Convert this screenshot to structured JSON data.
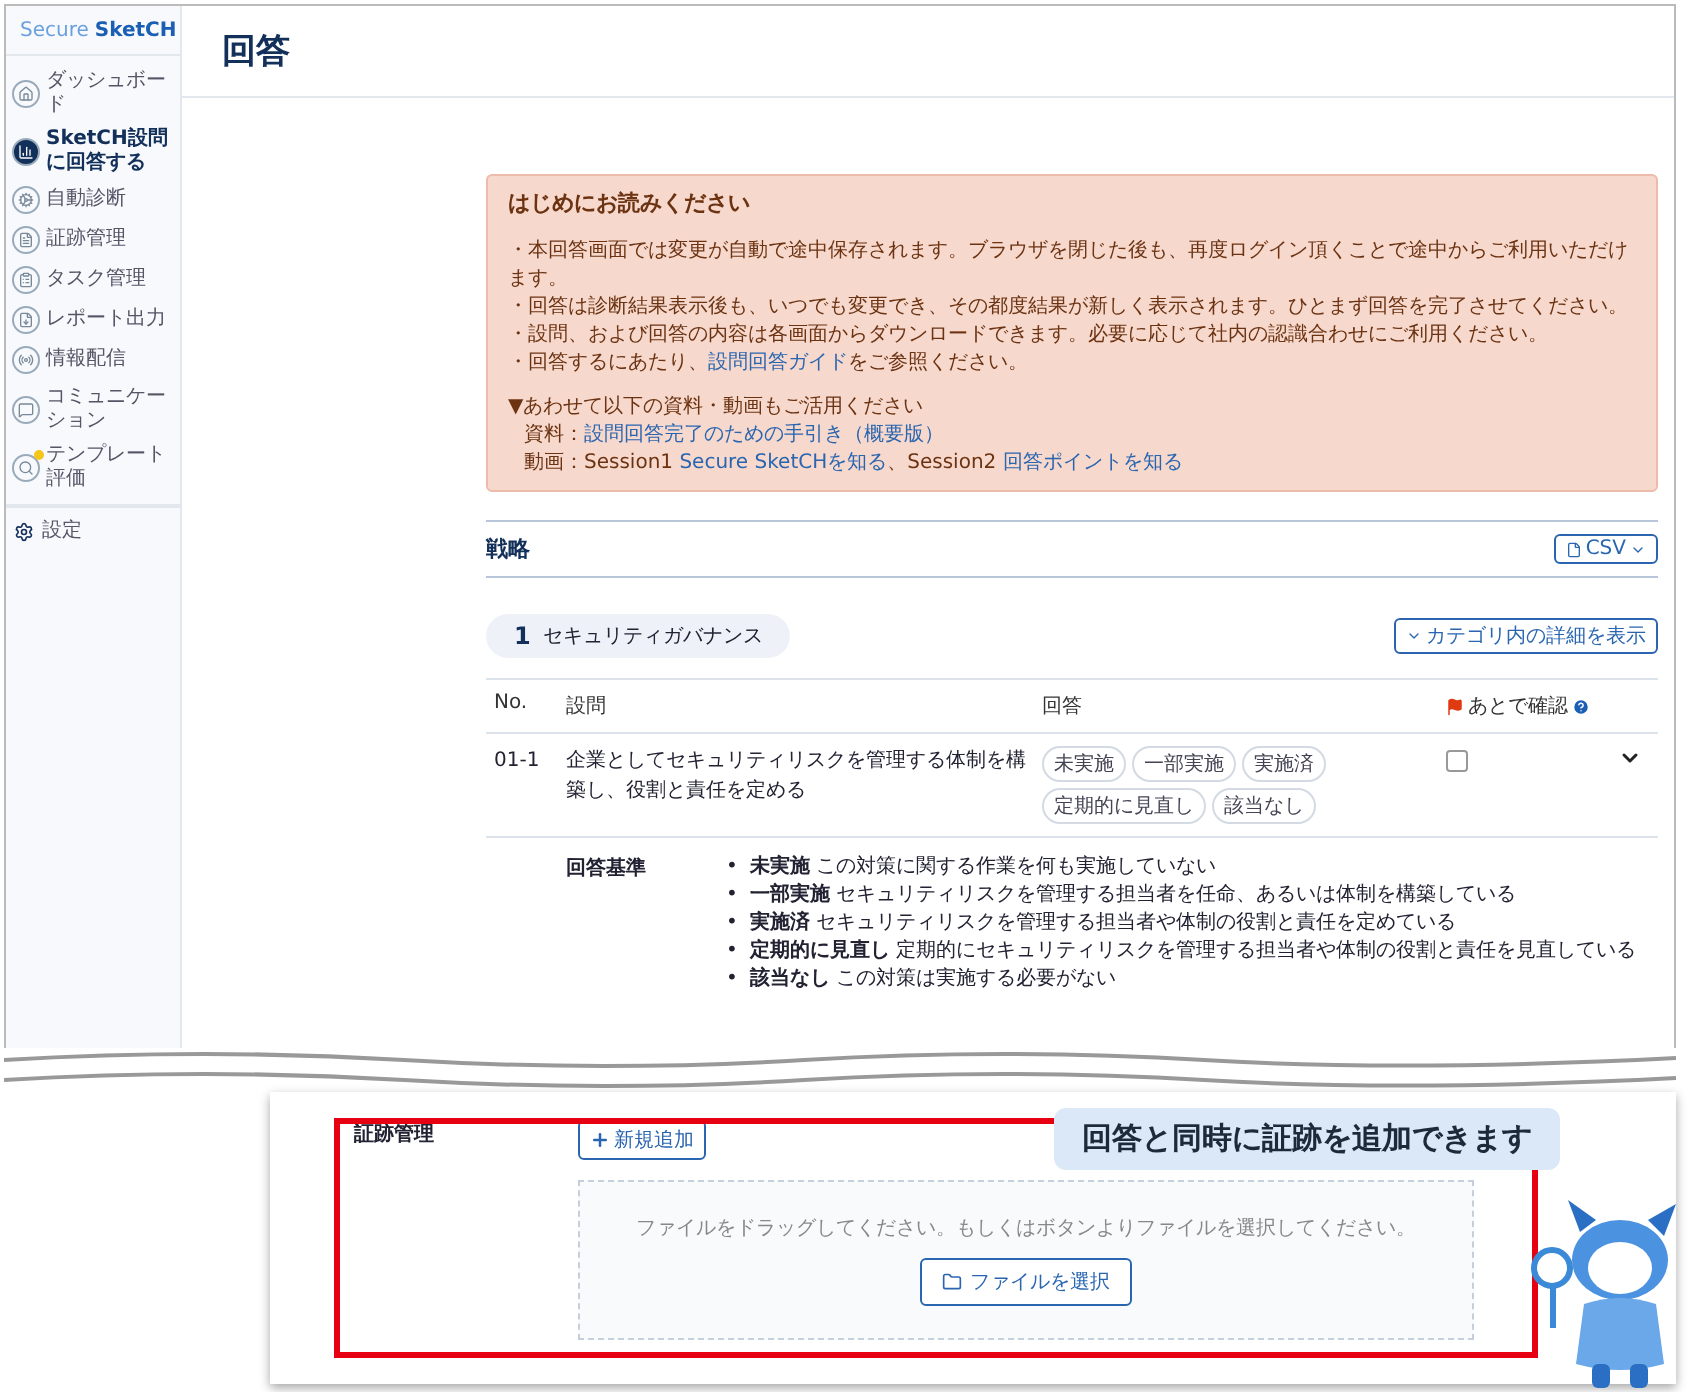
{
  "logo": [
    {
      "text": "Secure",
      "kind": "light"
    },
    {
      "text": "SketCH",
      "kind": "bold"
    }
  ],
  "sidebar": {
    "items": [
      {
        "label": "ダッシュボード",
        "selected": false,
        "new": false
      },
      {
        "label": "SketCH設問に回答する",
        "selected": true,
        "new": false
      },
      {
        "label": "自動診断",
        "selected": false,
        "new": false
      },
      {
        "label": "証跡管理",
        "selected": false,
        "new": false
      },
      {
        "label": "タスク管理",
        "selected": false,
        "new": false
      },
      {
        "label": "レポート出力",
        "selected": false,
        "new": false
      },
      {
        "label": "情報配信",
        "selected": false,
        "new": false
      },
      {
        "label": "コミュニケーション",
        "selected": false,
        "new": false
      },
      {
        "label": "テンプレート評価",
        "selected": false,
        "new": true
      }
    ],
    "settings": "設定"
  },
  "page": {
    "title": "回答"
  },
  "notice": {
    "title": "はじめにお読みください",
    "lines": [
      [
        {
          "text": "・本回答画面では変更が自動で途中保存されます。ブラウザを閉じた後も、再度ログイン頂くことで途中からご利用いただけます。",
          "link": false
        }
      ],
      [
        {
          "text": "・回答は診断結果表示後も、いつでも変更でき、その都度結果が新しく表示されます。ひとまず回答を完了させてください。",
          "link": false
        }
      ],
      [
        {
          "text": "・設問、および回答の内容は各画面からダウンロードできます。必要に応じて社内の認識合わせにご利用ください。",
          "link": false
        }
      ],
      [
        {
          "text": "・回答するにあたり、",
          "link": false
        },
        {
          "text": "設問回答ガイド",
          "link": true
        },
        {
          "text": "をご参照ください。",
          "link": false
        }
      ]
    ],
    "subtitle": "▼あわせて以下の資料・動画もご活用ください",
    "resources": [
      [
        {
          "text": "資料：",
          "link": false
        },
        {
          "text": "設問回答完了のための手引き（概要版）",
          "link": true
        }
      ],
      [
        {
          "text": "動画：Session1 ",
          "link": false
        },
        {
          "text": "Secure SketCHを知る",
          "link": true
        },
        {
          "text": "、Session2 ",
          "link": false
        },
        {
          "text": "回答ポイントを知る",
          "link": true
        }
      ]
    ]
  },
  "section": {
    "title": "戦略",
    "csv_button": "CSV"
  },
  "category": {
    "number": "1",
    "name": "セキュリティガバナンス",
    "detail_button": "カテゴリ内の詳細を表示"
  },
  "table": {
    "columns": [
      "No.",
      "設問",
      "回答",
      "あとで確認"
    ],
    "rows": [
      {
        "no": "01-1",
        "question": "企業としてセキュリティリスクを管理する体制を構築し、役割と責任を定める",
        "options": [
          {
            "label": "未実施",
            "selected": false
          },
          {
            "label": "一部実施",
            "selected": false
          },
          {
            "label": "実施済",
            "selected": false
          },
          {
            "label": "定期的に見直し",
            "selected": false
          },
          {
            "label": "該当なし",
            "selected": false
          }
        ],
        "flagged": false,
        "expanded": true,
        "criteria_label": "回答基準",
        "criteria": [
          {
            "marker": "•",
            "text": "**未実施** この対策に関する作業を何も実施していない"
          },
          {
            "marker": "•",
            "text": "**一部実施** セキュリティリスクを管理する担当者を任命、あるいは体制を構築している"
          },
          {
            "marker": "•",
            "text": "**実施済** セキュリティリスクを管理する担当者や体制の役割と責任を定めている"
          },
          {
            "marker": "•",
            "text": "**定期的に見直し** 定期的にセキュリティリスクを管理する担当者や体制の役割と責任を見直している"
          },
          {
            "marker": "•",
            "text": "**該当なし** この対策は実施する必要がない"
          }
        ]
      }
    ]
  },
  "evidence": {
    "label": "証跡管理",
    "add_button": "新規追加",
    "drop_hint": "ファイルをドラッグしてください。もしくはボタンよりファイルを選択してください。",
    "select_button": "ファイルを選択"
  },
  "callout": {
    "text": "回答と同時に証跡を追加できます"
  }
}
